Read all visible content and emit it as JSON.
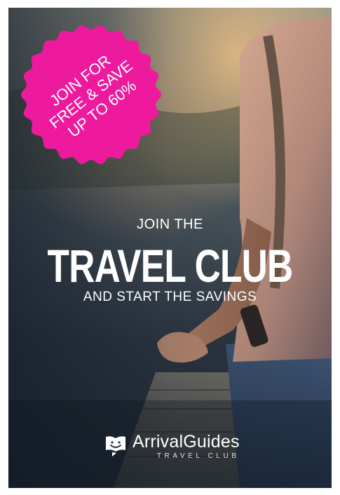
{
  "badge": {
    "line1": "JOIN FOR",
    "line2": "FREE & SAVE",
    "line3": "UP TO 60%",
    "color": "#ee1a9d"
  },
  "headline": {
    "top": "JOIN THE",
    "main": "TRAVEL CLUB",
    "bottom": "AND START THE SAVINGS"
  },
  "brand": {
    "name": "ArrivalGuides",
    "tagline": "TRAVEL CLUB",
    "icon": "book-smile-logo-icon"
  }
}
